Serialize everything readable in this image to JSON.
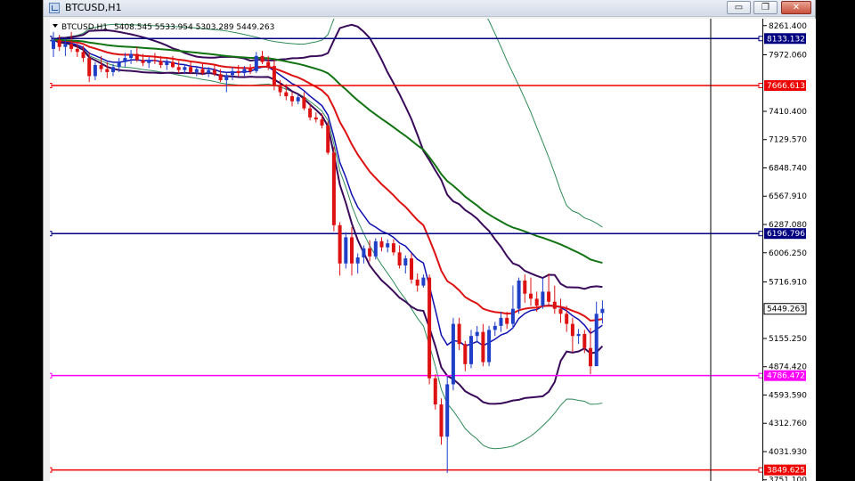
{
  "window": {
    "title": "BTCUSD,H1",
    "minimize_glyph": "▭",
    "restore_glyph": "❐",
    "close_glyph": "✕"
  },
  "chart_header": {
    "symbol": "BTCUSD,H1",
    "ohlc": "5408.545 5533.954 5303.289 5449.263"
  },
  "colors": {
    "bull": "#1f3fc8",
    "bear": "#dd1111",
    "ma_green": "#127312",
    "ma_red": "#dd1111",
    "ma_blue": "#1010b0",
    "band_purple": "#3a0a5a",
    "band_green": "#2e8b57",
    "level_blue": "#000080",
    "level_red": "#ee0000",
    "level_magenta": "#ff00ff"
  },
  "chart_data": {
    "type": "candlestick",
    "symbol": "BTCUSD",
    "timeframe": "H1",
    "ylim": [
      3740,
      8330
    ],
    "y_ticks": [
      "8261.400",
      "7972.060",
      "7410.400",
      "7129.570",
      "6848.740",
      "6567.910",
      "6287.080",
      "6006.250",
      "5716.910",
      "5155.250",
      "4874.420",
      "4593.590",
      "4312.760",
      "4031.930",
      "3751.100"
    ],
    "current_price": "5449.263",
    "levels": [
      {
        "value": 8133.132,
        "label": "8133.132",
        "color": "#000080"
      },
      {
        "value": 7666.613,
        "label": "7666.613",
        "color": "#ee0000"
      },
      {
        "value": 6196.796,
        "label": "6196.796",
        "color": "#000080"
      },
      {
        "value": 4786.472,
        "label": "4786.472",
        "color": "#ff00ff"
      },
      {
        "value": 3849.625,
        "label": "3849.625",
        "color": "#ee0000"
      }
    ],
    "candles": [
      [
        0,
        8030,
        8200,
        7950,
        8120
      ],
      [
        1,
        8120,
        8170,
        8010,
        8050
      ],
      [
        2,
        8050,
        8130,
        7960,
        8080
      ],
      [
        3,
        8080,
        8200,
        8000,
        8030
      ],
      [
        4,
        8030,
        8080,
        7950,
        8000
      ],
      [
        5,
        8000,
        8060,
        7900,
        7940
      ],
      [
        6,
        7940,
        8000,
        7700,
        7760
      ],
      [
        7,
        7760,
        7900,
        7720,
        7870
      ],
      [
        8,
        7870,
        7960,
        7800,
        7830
      ],
      [
        9,
        7830,
        7900,
        7740,
        7800
      ],
      [
        10,
        7800,
        7880,
        7760,
        7850
      ],
      [
        11,
        7850,
        7940,
        7800,
        7900
      ],
      [
        12,
        7900,
        7990,
        7850,
        7940
      ],
      [
        13,
        7940,
        8020,
        7880,
        7980
      ],
      [
        14,
        7980,
        8050,
        7900,
        7920
      ],
      [
        15,
        7920,
        7980,
        7860,
        7890
      ],
      [
        16,
        7890,
        7950,
        7840,
        7920
      ],
      [
        17,
        7920,
        7990,
        7880,
        7910
      ],
      [
        18,
        7910,
        7960,
        7840,
        7870
      ],
      [
        19,
        7870,
        7930,
        7820,
        7900
      ],
      [
        20,
        7900,
        7960,
        7840,
        7850
      ],
      [
        21,
        7850,
        7910,
        7790,
        7820
      ],
      [
        22,
        7820,
        7880,
        7780,
        7850
      ],
      [
        23,
        7850,
        7900,
        7780,
        7800
      ],
      [
        24,
        7800,
        7860,
        7760,
        7830
      ],
      [
        25,
        7830,
        7880,
        7770,
        7790
      ],
      [
        26,
        7790,
        7850,
        7750,
        7820
      ],
      [
        27,
        7820,
        7870,
        7760,
        7780
      ],
      [
        28,
        7780,
        7830,
        7700,
        7720
      ],
      [
        29,
        7720,
        7800,
        7600,
        7770
      ],
      [
        30,
        7770,
        7850,
        7720,
        7810
      ],
      [
        31,
        7810,
        7870,
        7760,
        7790
      ],
      [
        32,
        7790,
        7860,
        7760,
        7830
      ],
      [
        33,
        7830,
        7880,
        7780,
        7810
      ],
      [
        34,
        7810,
        8000,
        7790,
        7960
      ],
      [
        35,
        7960,
        8010,
        7880,
        7900
      ],
      [
        36,
        7900,
        7960,
        7820,
        7860
      ],
      [
        37,
        7860,
        7920,
        7620,
        7660
      ],
      [
        38,
        7660,
        7720,
        7560,
        7600
      ],
      [
        39,
        7600,
        7680,
        7520,
        7560
      ],
      [
        40,
        7560,
        7600,
        7460,
        7510
      ],
      [
        41,
        7510,
        7580,
        7480,
        7550
      ],
      [
        42,
        7550,
        7600,
        7420,
        7440
      ],
      [
        43,
        7440,
        7480,
        7320,
        7350
      ],
      [
        44,
        7350,
        7400,
        7300,
        7330
      ],
      [
        45,
        7330,
        7390,
        7240,
        7270
      ],
      [
        46,
        7270,
        7310,
        6980,
        7000
      ],
      [
        47,
        7000,
        7060,
        6220,
        6280
      ],
      [
        48,
        6280,
        6310,
        5780,
        5900
      ],
      [
        49,
        5900,
        6210,
        5850,
        6160
      ],
      [
        50,
        6160,
        6260,
        5780,
        5900
      ],
      [
        51,
        5900,
        6000,
        5800,
        5960
      ],
      [
        52,
        5960,
        6080,
        5900,
        6050
      ],
      [
        53,
        6050,
        6130,
        5920,
        5970
      ],
      [
        54,
        5970,
        6150,
        5940,
        6120
      ],
      [
        55,
        6120,
        6160,
        6020,
        6060
      ],
      [
        56,
        6060,
        6140,
        6010,
        6100
      ],
      [
        57,
        6100,
        6140,
        5980,
        6010
      ],
      [
        58,
        6010,
        6080,
        5850,
        5880
      ],
      [
        59,
        5880,
        5980,
        5800,
        5950
      ],
      [
        60,
        5950,
        6000,
        5700,
        5740
      ],
      [
        61,
        5740,
        5800,
        5620,
        5680
      ],
      [
        62,
        5680,
        5790,
        5660,
        5760
      ],
      [
        63,
        5760,
        5790,
        4700,
        4760
      ],
      [
        64,
        4760,
        4800,
        4450,
        4500
      ],
      [
        65,
        4500,
        4560,
        4100,
        4180
      ],
      [
        66,
        4180,
        4780,
        3820,
        4700
      ],
      [
        67,
        4700,
        5360,
        4640,
        5300
      ],
      [
        68,
        5300,
        5360,
        5040,
        5100
      ],
      [
        69,
        5100,
        5130,
        4830,
        4900
      ],
      [
        70,
        4900,
        5240,
        4860,
        5180
      ],
      [
        71,
        5180,
        5280,
        5120,
        5220
      ],
      [
        72,
        5220,
        5300,
        4880,
        4920
      ],
      [
        73,
        4920,
        5280,
        4880,
        5240
      ],
      [
        74,
        5240,
        5320,
        5180,
        5280
      ],
      [
        75,
        5280,
        5420,
        5220,
        5360
      ],
      [
        76,
        5360,
        5420,
        5250,
        5300
      ],
      [
        77,
        5300,
        5680,
        5260,
        5450
      ],
      [
        78,
        5450,
        5760,
        5400,
        5730
      ],
      [
        79,
        5730,
        5790,
        5510,
        5600
      ],
      [
        80,
        5600,
        5760,
        5480,
        5550
      ],
      [
        81,
        5550,
        5620,
        5420,
        5480
      ],
      [
        82,
        5480,
        5760,
        5450,
        5620
      ],
      [
        83,
        5620,
        5800,
        5480,
        5520
      ],
      [
        84,
        5520,
        5680,
        5400,
        5450
      ],
      [
        85,
        5450,
        5550,
        5310,
        5400
      ],
      [
        86,
        5400,
        5480,
        5220,
        5300
      ],
      [
        87,
        5300,
        5360,
        5020,
        5180
      ],
      [
        88,
        5180,
        5250,
        5100,
        5200
      ],
      [
        89,
        5200,
        5240,
        5010,
        5060
      ],
      [
        90,
        5060,
        5260,
        4800,
        4880
      ],
      [
        91,
        4880,
        5520,
        4900,
        5400
      ],
      [
        92,
        5408,
        5534,
        5303,
        5449
      ]
    ]
  }
}
